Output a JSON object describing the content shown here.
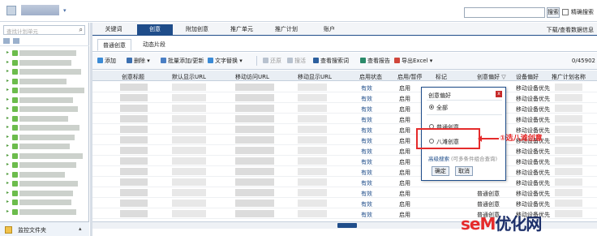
{
  "topbar": {
    "search_button": "搜索",
    "exact_search": "精确搜索"
  },
  "sidebar": {
    "search_placeholder": "查找计划单元",
    "footer_label": "监控文件夹"
  },
  "tabs": [
    {
      "label": "关键词",
      "active": false
    },
    {
      "label": "创意",
      "active": true
    },
    {
      "label": "附加创意",
      "active": false
    },
    {
      "label": "推广单元",
      "active": false
    },
    {
      "label": "推广计划",
      "active": false
    },
    {
      "label": "账户",
      "active": false
    }
  ],
  "tabs_right": "下载/查看数据信息",
  "subtabs": [
    {
      "label": "普通创意",
      "active": true
    },
    {
      "label": "动态片段",
      "active": false
    }
  ],
  "toolbar": {
    "add": "添加",
    "delete": "删除",
    "batch": "批量添加/更新",
    "replace": "文字替换",
    "revert": "还原",
    "refresh": "搜活",
    "search_words": "查看搜索词",
    "report": "查看报告",
    "export": "导出Excel",
    "count": "0/45902"
  },
  "columns": [
    "创意标题",
    "默认显示URL",
    "移动访问URL",
    "移动显示URL",
    "启用状态",
    "启用/暂停",
    "标记",
    "创意偏好",
    "设备偏好",
    "推广计划名称"
  ],
  "rows": [
    {
      "status": "有效",
      "state": "启用",
      "pref": "",
      "device": "移动设备优先"
    },
    {
      "status": "有效",
      "state": "启用",
      "pref": "",
      "device": "移动设备优先"
    },
    {
      "status": "有效",
      "state": "启用",
      "pref": "",
      "device": "移动设备优先"
    },
    {
      "status": "有效",
      "state": "启用",
      "pref": "",
      "device": "移动设备优先"
    },
    {
      "status": "有效",
      "state": "启用",
      "pref": "",
      "device": "移动设备优先"
    },
    {
      "status": "有效",
      "state": "启用",
      "pref": "",
      "device": "移动设备优先"
    },
    {
      "status": "有效",
      "state": "启用",
      "pref": "",
      "device": "移动设备优先"
    },
    {
      "status": "有效",
      "state": "启用",
      "pref": "",
      "device": "移动设备优先"
    },
    {
      "status": "有效",
      "state": "启用",
      "pref": "",
      "device": "移动设备优先"
    },
    {
      "status": "有效",
      "state": "启用",
      "pref": "",
      "device": "移动设备优先"
    },
    {
      "status": "有效",
      "state": "启用",
      "pref": "普通创意",
      "device": "移动设备优先"
    },
    {
      "status": "有效",
      "state": "启用",
      "pref": "普通创意",
      "device": "移动设备优先"
    },
    {
      "status": "有效",
      "state": "启用",
      "pref": "普通创意",
      "device": "移动设备优先"
    }
  ],
  "popup": {
    "title": "创意偏好",
    "close": "x",
    "option_all": "全部",
    "option_normal": "普通创意",
    "option_eight": "八滩创意",
    "adv_search": "高级搜索",
    "adv_hint": "(可多条件组合查询)",
    "ok": "确定",
    "cancel": "取消"
  },
  "annotation": "①选八滩创意",
  "watermark": {
    "part1": "seM",
    "part2": "优化网"
  },
  "colors": {
    "accent": "#1f4d8a",
    "annotation": "#e52b2b"
  }
}
